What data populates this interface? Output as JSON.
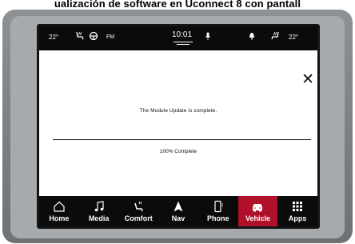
{
  "caption": "ualización de software en Uconnect 8 con pantall",
  "status_bar": {
    "temp_left": "22°",
    "band": "FM",
    "clock": "10:01",
    "temp_right": "22°"
  },
  "dialog": {
    "message": "The Module Update is complete.",
    "progress_text": "100% Complete",
    "progress_percent": 100,
    "close_symbol": "✕"
  },
  "nav": {
    "active": "Vehicle",
    "active_color": "#b0102a",
    "items": [
      {
        "label": "Home",
        "icon": "home-icon"
      },
      {
        "label": "Media",
        "icon": "music-note-icon"
      },
      {
        "label": "Comfort",
        "icon": "seat-climate-icon"
      },
      {
        "label": "Nav",
        "icon": "navigation-arrow-icon"
      },
      {
        "label": "Phone",
        "icon": "phone-icon"
      },
      {
        "label": "Vehicle",
        "icon": "car-icon"
      },
      {
        "label": "Apps",
        "icon": "apps-grid-icon"
      }
    ]
  }
}
